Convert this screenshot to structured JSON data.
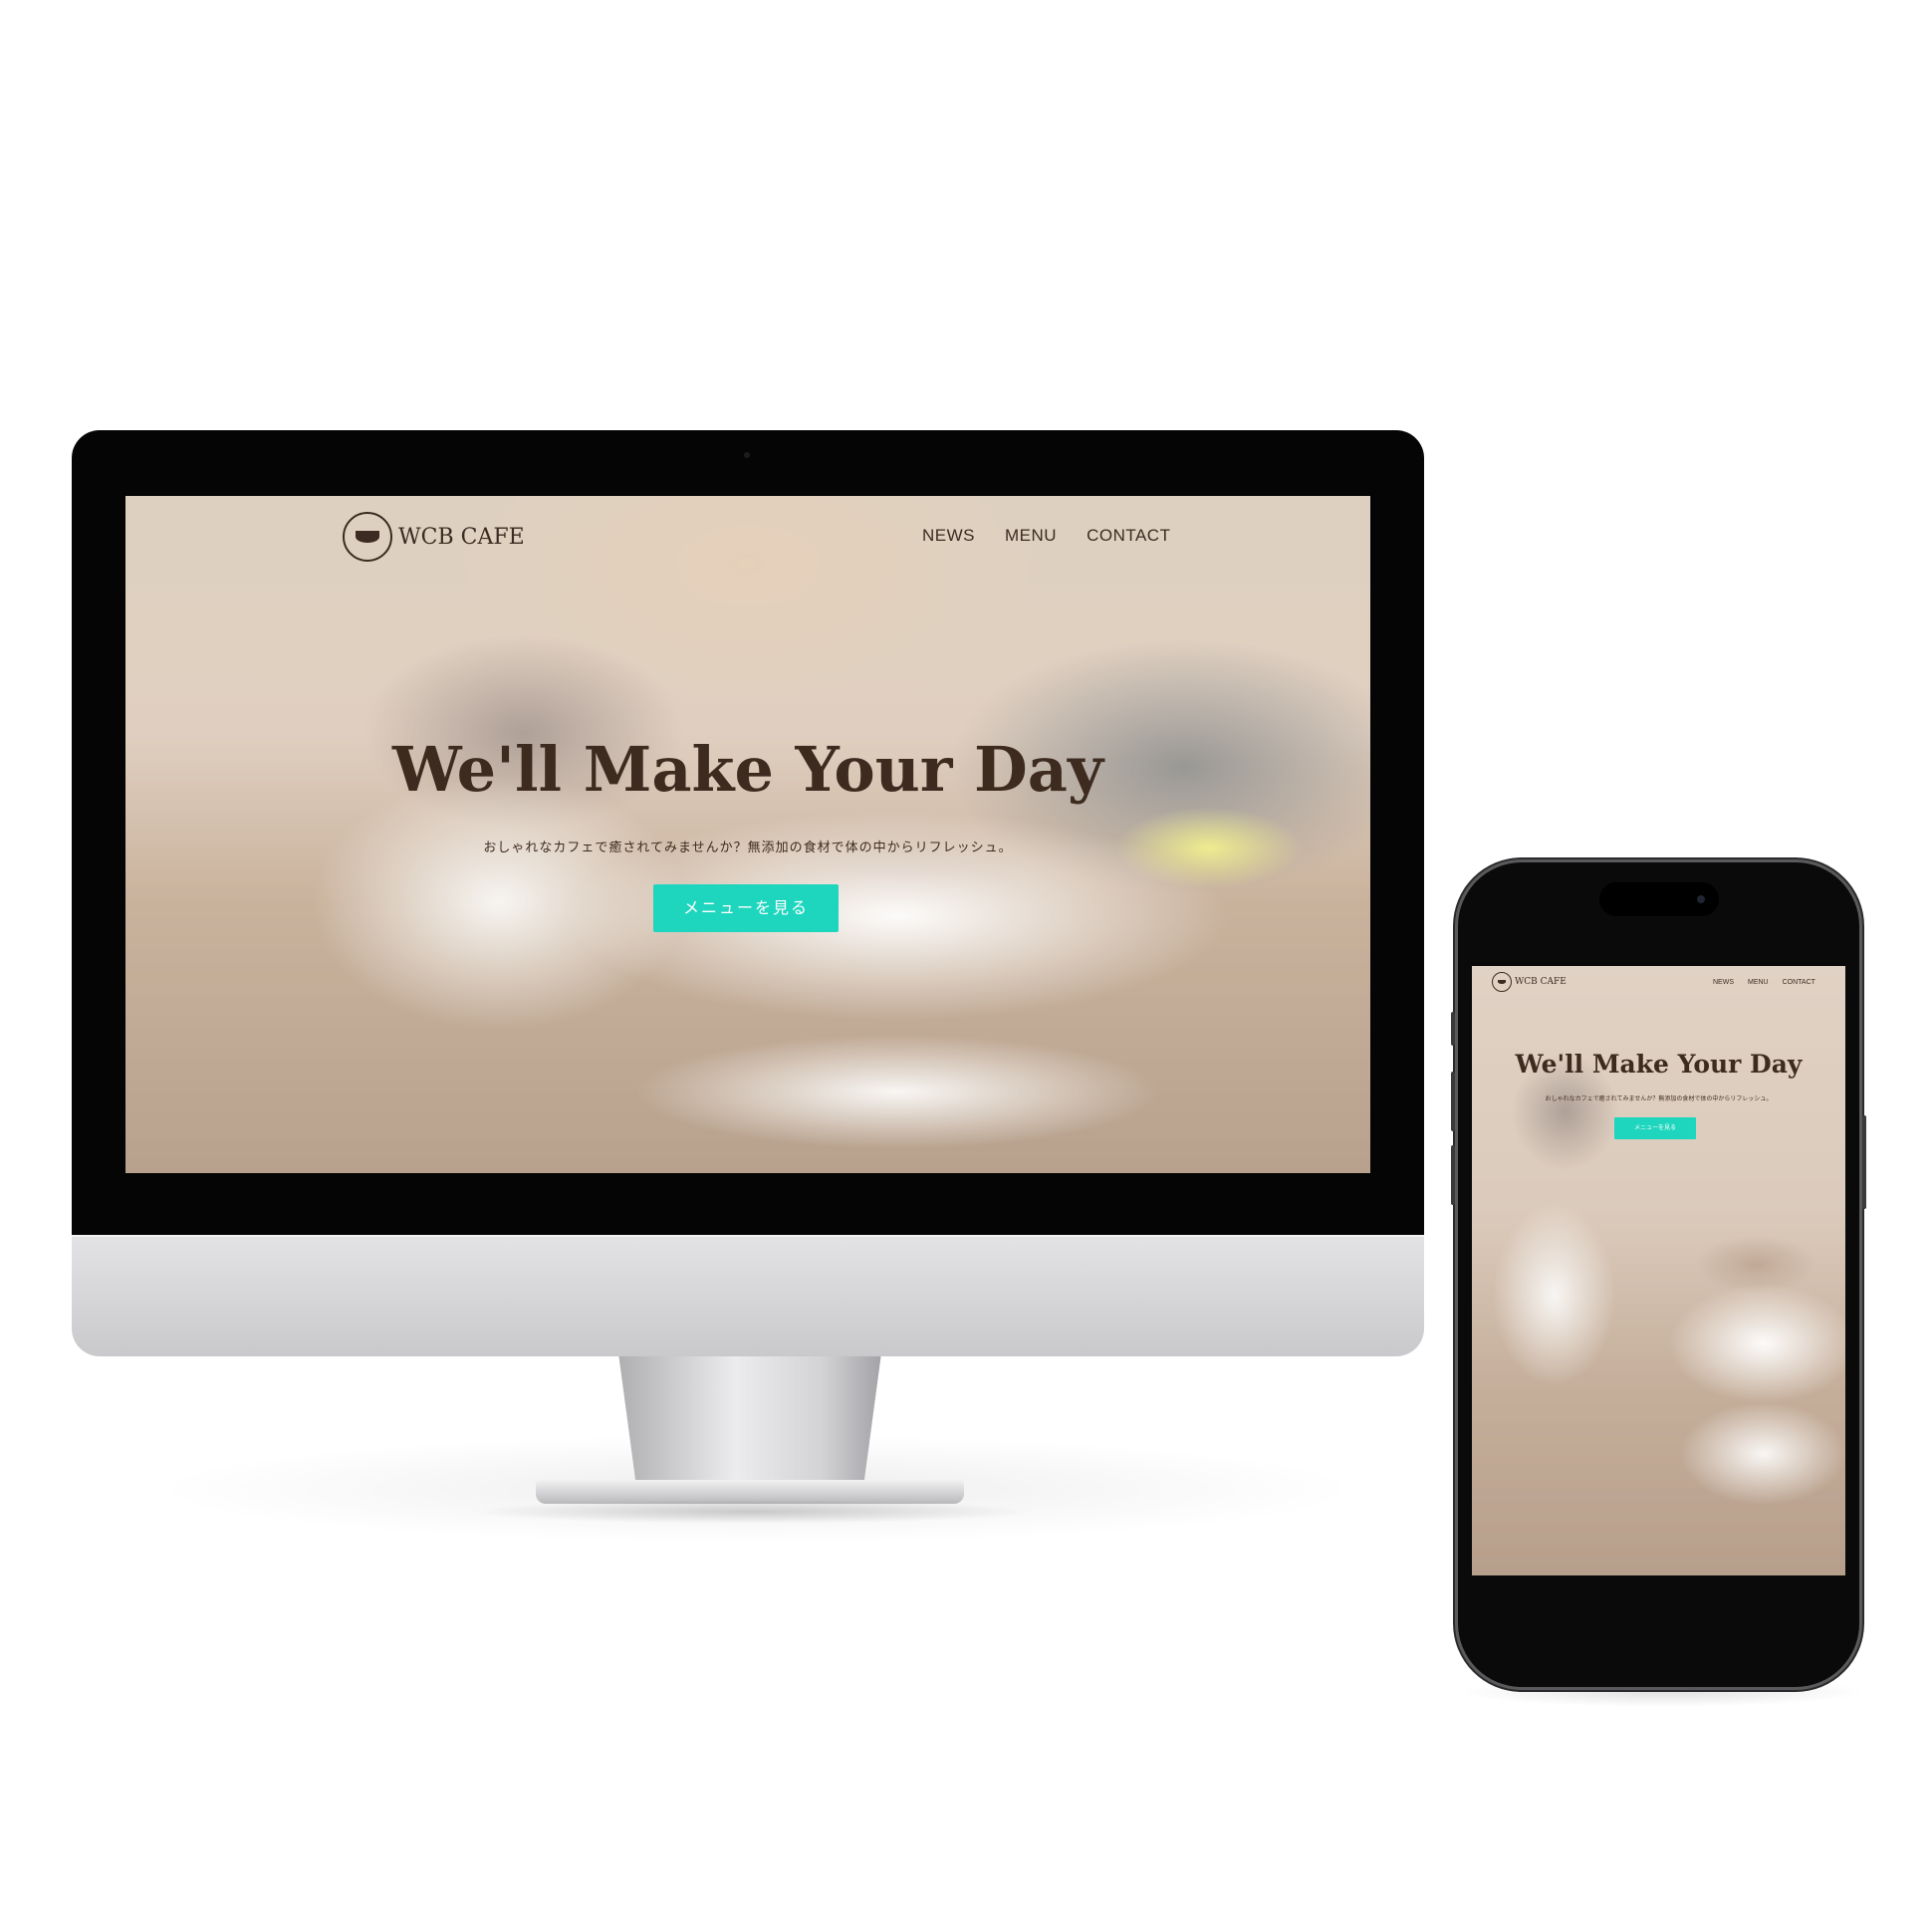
{
  "site": {
    "logo_text": "WCB CAFE",
    "nav": [
      "NEWS",
      "MENU",
      "CONTACT"
    ],
    "hero_title": "We'll Make Your Day",
    "hero_subtitle": "おしゃれなカフェで癒されてみませんか？無添加の食材で体の中からリフレッシュ。",
    "cta_label": "メニューを見る",
    "colors": {
      "accent": "#1ed6bd",
      "text": "#3e2b20"
    }
  },
  "devices": {
    "desktop": "imac",
    "mobile": "iphone"
  }
}
